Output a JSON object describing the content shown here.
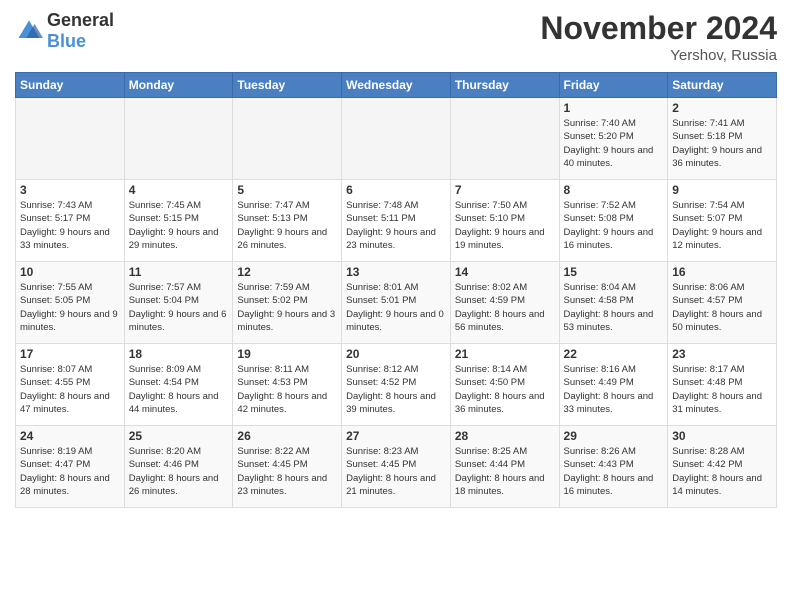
{
  "logo": {
    "general": "General",
    "blue": "Blue"
  },
  "title": "November 2024",
  "location": "Yershov, Russia",
  "weekdays": [
    "Sunday",
    "Monday",
    "Tuesday",
    "Wednesday",
    "Thursday",
    "Friday",
    "Saturday"
  ],
  "weeks": [
    [
      {
        "day": "",
        "info": ""
      },
      {
        "day": "",
        "info": ""
      },
      {
        "day": "",
        "info": ""
      },
      {
        "day": "",
        "info": ""
      },
      {
        "day": "",
        "info": ""
      },
      {
        "day": "1",
        "info": "Sunrise: 7:40 AM\nSunset: 5:20 PM\nDaylight: 9 hours and 40 minutes."
      },
      {
        "day": "2",
        "info": "Sunrise: 7:41 AM\nSunset: 5:18 PM\nDaylight: 9 hours and 36 minutes."
      }
    ],
    [
      {
        "day": "3",
        "info": "Sunrise: 7:43 AM\nSunset: 5:17 PM\nDaylight: 9 hours and 33 minutes."
      },
      {
        "day": "4",
        "info": "Sunrise: 7:45 AM\nSunset: 5:15 PM\nDaylight: 9 hours and 29 minutes."
      },
      {
        "day": "5",
        "info": "Sunrise: 7:47 AM\nSunset: 5:13 PM\nDaylight: 9 hours and 26 minutes."
      },
      {
        "day": "6",
        "info": "Sunrise: 7:48 AM\nSunset: 5:11 PM\nDaylight: 9 hours and 23 minutes."
      },
      {
        "day": "7",
        "info": "Sunrise: 7:50 AM\nSunset: 5:10 PM\nDaylight: 9 hours and 19 minutes."
      },
      {
        "day": "8",
        "info": "Sunrise: 7:52 AM\nSunset: 5:08 PM\nDaylight: 9 hours and 16 minutes."
      },
      {
        "day": "9",
        "info": "Sunrise: 7:54 AM\nSunset: 5:07 PM\nDaylight: 9 hours and 12 minutes."
      }
    ],
    [
      {
        "day": "10",
        "info": "Sunrise: 7:55 AM\nSunset: 5:05 PM\nDaylight: 9 hours and 9 minutes."
      },
      {
        "day": "11",
        "info": "Sunrise: 7:57 AM\nSunset: 5:04 PM\nDaylight: 9 hours and 6 minutes."
      },
      {
        "day": "12",
        "info": "Sunrise: 7:59 AM\nSunset: 5:02 PM\nDaylight: 9 hours and 3 minutes."
      },
      {
        "day": "13",
        "info": "Sunrise: 8:01 AM\nSunset: 5:01 PM\nDaylight: 9 hours and 0 minutes."
      },
      {
        "day": "14",
        "info": "Sunrise: 8:02 AM\nSunset: 4:59 PM\nDaylight: 8 hours and 56 minutes."
      },
      {
        "day": "15",
        "info": "Sunrise: 8:04 AM\nSunset: 4:58 PM\nDaylight: 8 hours and 53 minutes."
      },
      {
        "day": "16",
        "info": "Sunrise: 8:06 AM\nSunset: 4:57 PM\nDaylight: 8 hours and 50 minutes."
      }
    ],
    [
      {
        "day": "17",
        "info": "Sunrise: 8:07 AM\nSunset: 4:55 PM\nDaylight: 8 hours and 47 minutes."
      },
      {
        "day": "18",
        "info": "Sunrise: 8:09 AM\nSunset: 4:54 PM\nDaylight: 8 hours and 44 minutes."
      },
      {
        "day": "19",
        "info": "Sunrise: 8:11 AM\nSunset: 4:53 PM\nDaylight: 8 hours and 42 minutes."
      },
      {
        "day": "20",
        "info": "Sunrise: 8:12 AM\nSunset: 4:52 PM\nDaylight: 8 hours and 39 minutes."
      },
      {
        "day": "21",
        "info": "Sunrise: 8:14 AM\nSunset: 4:50 PM\nDaylight: 8 hours and 36 minutes."
      },
      {
        "day": "22",
        "info": "Sunrise: 8:16 AM\nSunset: 4:49 PM\nDaylight: 8 hours and 33 minutes."
      },
      {
        "day": "23",
        "info": "Sunrise: 8:17 AM\nSunset: 4:48 PM\nDaylight: 8 hours and 31 minutes."
      }
    ],
    [
      {
        "day": "24",
        "info": "Sunrise: 8:19 AM\nSunset: 4:47 PM\nDaylight: 8 hours and 28 minutes."
      },
      {
        "day": "25",
        "info": "Sunrise: 8:20 AM\nSunset: 4:46 PM\nDaylight: 8 hours and 26 minutes."
      },
      {
        "day": "26",
        "info": "Sunrise: 8:22 AM\nSunset: 4:45 PM\nDaylight: 8 hours and 23 minutes."
      },
      {
        "day": "27",
        "info": "Sunrise: 8:23 AM\nSunset: 4:45 PM\nDaylight: 8 hours and 21 minutes."
      },
      {
        "day": "28",
        "info": "Sunrise: 8:25 AM\nSunset: 4:44 PM\nDaylight: 8 hours and 18 minutes."
      },
      {
        "day": "29",
        "info": "Sunrise: 8:26 AM\nSunset: 4:43 PM\nDaylight: 8 hours and 16 minutes."
      },
      {
        "day": "30",
        "info": "Sunrise: 8:28 AM\nSunset: 4:42 PM\nDaylight: 8 hours and 14 minutes."
      }
    ]
  ]
}
